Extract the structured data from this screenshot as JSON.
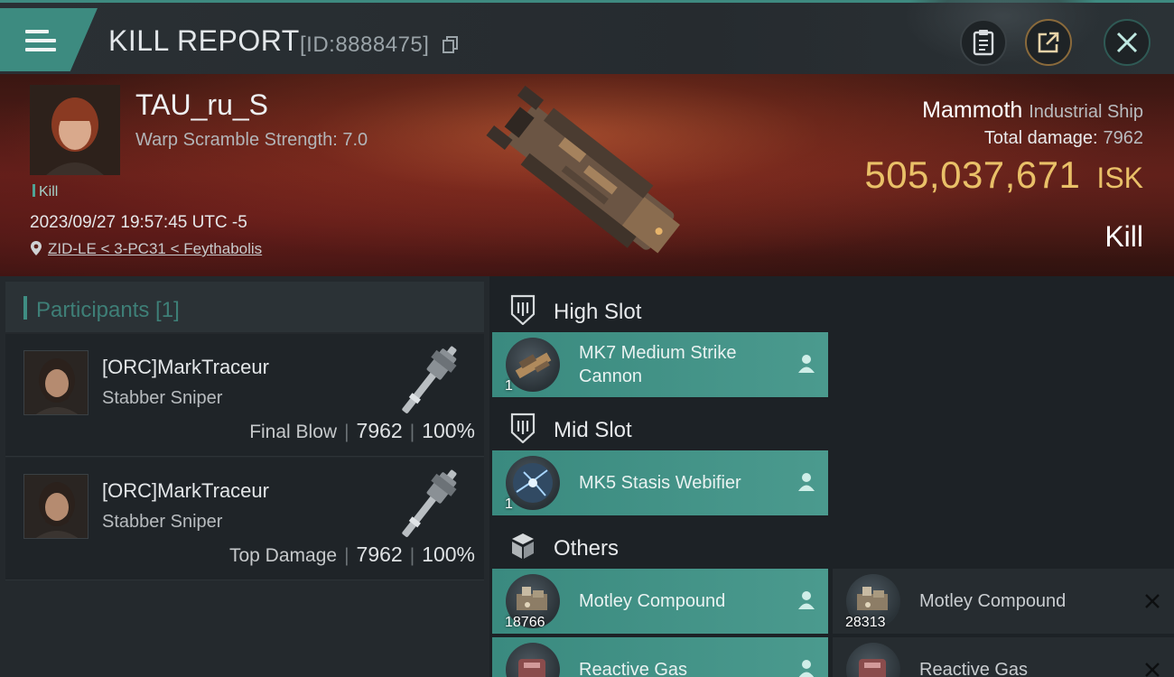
{
  "header": {
    "title": "KILL REPORT",
    "kill_id": "[ID:8888475]"
  },
  "victim": {
    "name": "TAU_ru_S",
    "scramble": "Warp Scramble Strength: 7.0",
    "tag": "Kill",
    "datetime": "2023/09/27 19:57:45 UTC -5",
    "location": "ZID-LE < 3-PC31 < Feythabolis"
  },
  "ship": {
    "name": "Mammoth",
    "class": "Industrial Ship",
    "total_damage_label": "Total damage:",
    "total_damage": "7962",
    "isk_value": "505,037,671",
    "isk_unit": "ISK",
    "result": "Kill"
  },
  "participants": {
    "header": "Participants [1]",
    "items": [
      {
        "name": "[ORC]MarkTraceur",
        "ship": "Stabber Sniper",
        "label": "Final Blow",
        "damage": "7962",
        "percent": "100%"
      },
      {
        "name": "[ORC]MarkTraceur",
        "ship": "Stabber Sniper",
        "label": "Top Damage",
        "damage": "7962",
        "percent": "100%"
      }
    ]
  },
  "slots": {
    "high": {
      "title": "High Slot",
      "items": [
        {
          "name": "MK7 Medium Strike Cannon",
          "qty": "1"
        }
      ]
    },
    "mid": {
      "title": "Mid Slot",
      "items": [
        {
          "name": "MK5 Stasis Webifier",
          "qty": "1"
        }
      ]
    },
    "others": {
      "title": "Others",
      "dropped": [
        {
          "name": "Motley Compound",
          "qty": "18766"
        },
        {
          "name": "Reactive Gas",
          "qty": ""
        }
      ],
      "destroyed": [
        {
          "name": "Motley Compound",
          "qty": "28313"
        },
        {
          "name": "Reactive Gas",
          "qty": ""
        }
      ]
    }
  },
  "colors": {
    "accent_teal": "#3d8b80",
    "isk_gold": "#e9c068",
    "banner_red": "#5a1f18"
  },
  "icons": [
    "menu-icon",
    "copy-icon",
    "clipboard-icon",
    "share-icon",
    "close-icon",
    "location-pin-icon",
    "slot-shield-icon",
    "cube-icon",
    "pilot-icon",
    "x-icon"
  ]
}
